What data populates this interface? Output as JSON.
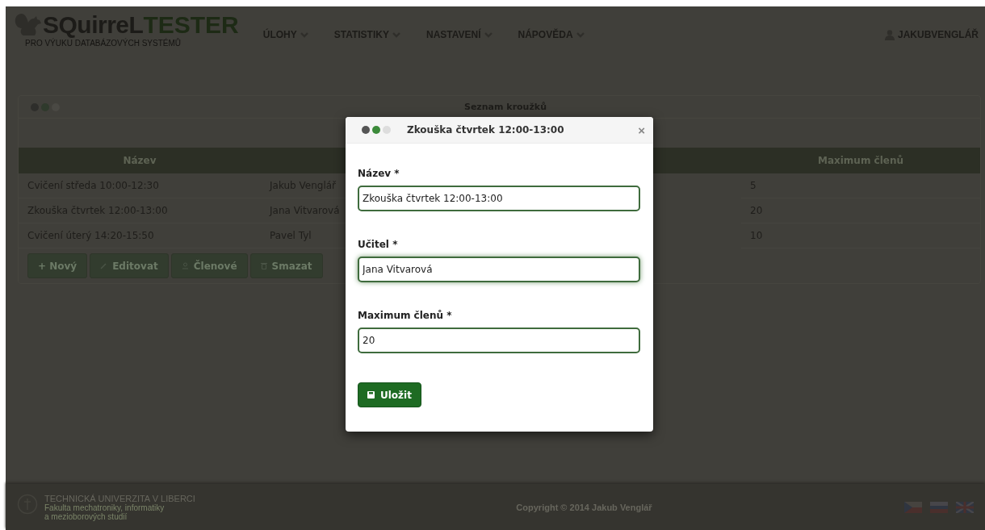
{
  "header": {
    "logo_main": "SQuirreL",
    "logo_accent": "TESTER",
    "tagline": "PRO VÝUKU DATABÁZOVÝCH SYSTÉMŮ",
    "menu": [
      {
        "label": "ÚLOHY"
      },
      {
        "label": "STATISTIKY"
      },
      {
        "label": "NASTAVENÍ"
      },
      {
        "label": "NÁPOVĚDA"
      }
    ],
    "user": "JAKUBVENGLÁŘ"
  },
  "panel": {
    "title": "Seznam kroužků",
    "table": {
      "columns": [
        "Název",
        null,
        null,
        "Maximum členů"
      ],
      "rows": [
        [
          "Cvičení středa 10:00-12:30",
          "Jakub Venglář",
          null,
          "5"
        ],
        [
          "Zkouška čtvrtek 12:00-13:00",
          "Jana Vitvarová",
          null,
          "20"
        ],
        [
          "Cvičení úterý 14:20-15:50",
          "Pavel Tyl",
          null,
          "10"
        ]
      ]
    },
    "buttons": [
      {
        "kind": "add",
        "label": "+ Nový"
      },
      {
        "kind": "edit",
        "label": "Editovat"
      },
      {
        "kind": "members",
        "label": "Členové"
      },
      {
        "kind": "delete",
        "label": "Smazat"
      }
    ]
  },
  "modal": {
    "title": "Zkouška čtvrtek 12:00-13:00",
    "close": "×",
    "fields": [
      {
        "label": "Název *",
        "value": "Zkouška čtvrtek 12:00-13:00",
        "focused": false
      },
      {
        "label": "Učitel *",
        "value": "Jana Vitvarová",
        "focused": true
      },
      {
        "label": "Maximum členů *",
        "value": "20",
        "focused": false
      }
    ],
    "save": "Uložit"
  },
  "footer": {
    "university": "TECHNICKÁ UNIVERZITA V LIBERCI",
    "faculty_line_1": "Fakulta mechatroniky, informatiky",
    "faculty_line_2": "a mezioborových studií",
    "copyright": "Copyright © 2014 Jakub Venglář"
  }
}
